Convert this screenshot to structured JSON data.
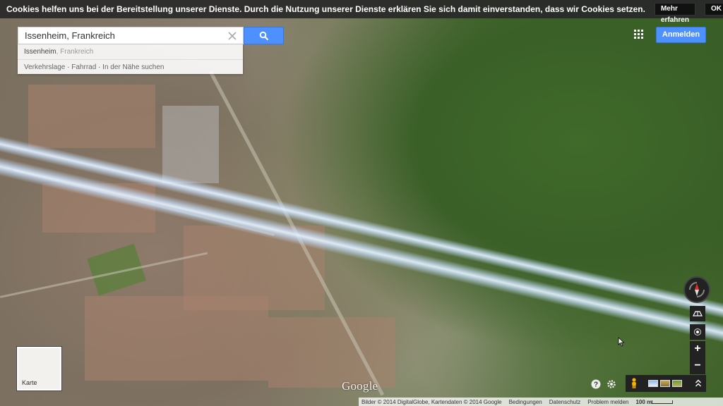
{
  "cookie_bar": {
    "text": "Cookies helfen uns bei der Bereitstellung unserer Dienste. Durch die Nutzung unserer Dienste erklären Sie sich damit einverstanden, dass wir Cookies setzen.",
    "learn_more_label": "Mehr erfahren",
    "ok_label": "OK"
  },
  "search": {
    "value": "Issenheim, Frankreich",
    "button_icon": "search-icon",
    "clear_icon": "close-icon"
  },
  "suggestions": {
    "primary": "Issenheim",
    "secondary": ", Frankreich",
    "links": [
      "Verkehrslage",
      "Fahrrad",
      "In der Nähe suchen"
    ],
    "separator": " · "
  },
  "header": {
    "apps_icon": "apps-grid-icon",
    "signin_label": "Anmelden",
    "accent_color": "#4d90fe"
  },
  "controls": {
    "compass_icon": "compass-icon",
    "tilt_icon": "tilt-icon",
    "location_icon": "my-location-icon",
    "zoom_in_label": "+",
    "zoom_out_label": "−",
    "help_icon": "help-icon",
    "settings_icon": "gear-icon",
    "pegman_icon": "pegman-icon",
    "expand_icon": "chevron-up-icon"
  },
  "layer_switcher": {
    "label": "Karte"
  },
  "logo": {
    "text": "Google"
  },
  "footer": {
    "attribution": "Bilder © 2014 DigitalGlobe, Kartendaten © 2014 Google",
    "terms": "Bedingungen",
    "privacy": "Datenschutz",
    "report": "Problem melden",
    "scale": "100 m"
  }
}
